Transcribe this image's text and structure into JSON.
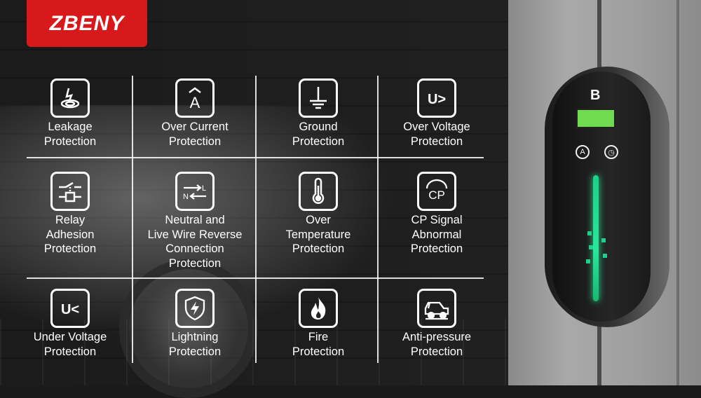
{
  "brand": {
    "logo_text": "ZBENY",
    "color": "#d7191c"
  },
  "features": [
    {
      "icon": "leakage-icon",
      "lines": [
        "Leakage",
        "Protection"
      ]
    },
    {
      "icon": "over-current-icon",
      "lines": [
        "Over Current",
        "Protection"
      ]
    },
    {
      "icon": "ground-icon",
      "lines": [
        "Ground",
        "Protection"
      ]
    },
    {
      "icon": "over-voltage-icon",
      "lines": [
        "Over Voltage",
        "Protection"
      ]
    },
    {
      "icon": "relay-adhesion-icon",
      "lines": [
        "Relay",
        "Adhesion",
        "Protection"
      ]
    },
    {
      "icon": "neutral-live-wire-icon",
      "lines": [
        "Neutral and",
        "Live Wire Reverse",
        "Connection",
        "Protection"
      ]
    },
    {
      "icon": "thermometer-icon",
      "lines": [
        "Over",
        "Temperature",
        "Protection"
      ]
    },
    {
      "icon": "cp-signal-icon",
      "lines": [
        "CP Signal",
        "Abnormal",
        "Protection"
      ]
    },
    {
      "icon": "under-voltage-icon",
      "lines": [
        "Under Voltage",
        "Protection"
      ]
    },
    {
      "icon": "lightning-shield-icon",
      "lines": [
        "Lightning",
        "Protection"
      ]
    },
    {
      "icon": "fire-icon",
      "lines": [
        "Fire",
        "Protection"
      ]
    },
    {
      "icon": "anti-pressure-car-icon",
      "lines": [
        "Anti-pressure",
        "Protection"
      ]
    }
  ],
  "icon_text": {
    "over_current": "A",
    "over_voltage": "U>",
    "under_voltage": "U<",
    "cp_signal": "CP",
    "neutral_live_l": "L",
    "neutral_live_n": "N"
  },
  "charger": {
    "logo": "B",
    "button_a": "A",
    "light_color": "#26e095",
    "screen_color": "#6fdc4f"
  }
}
